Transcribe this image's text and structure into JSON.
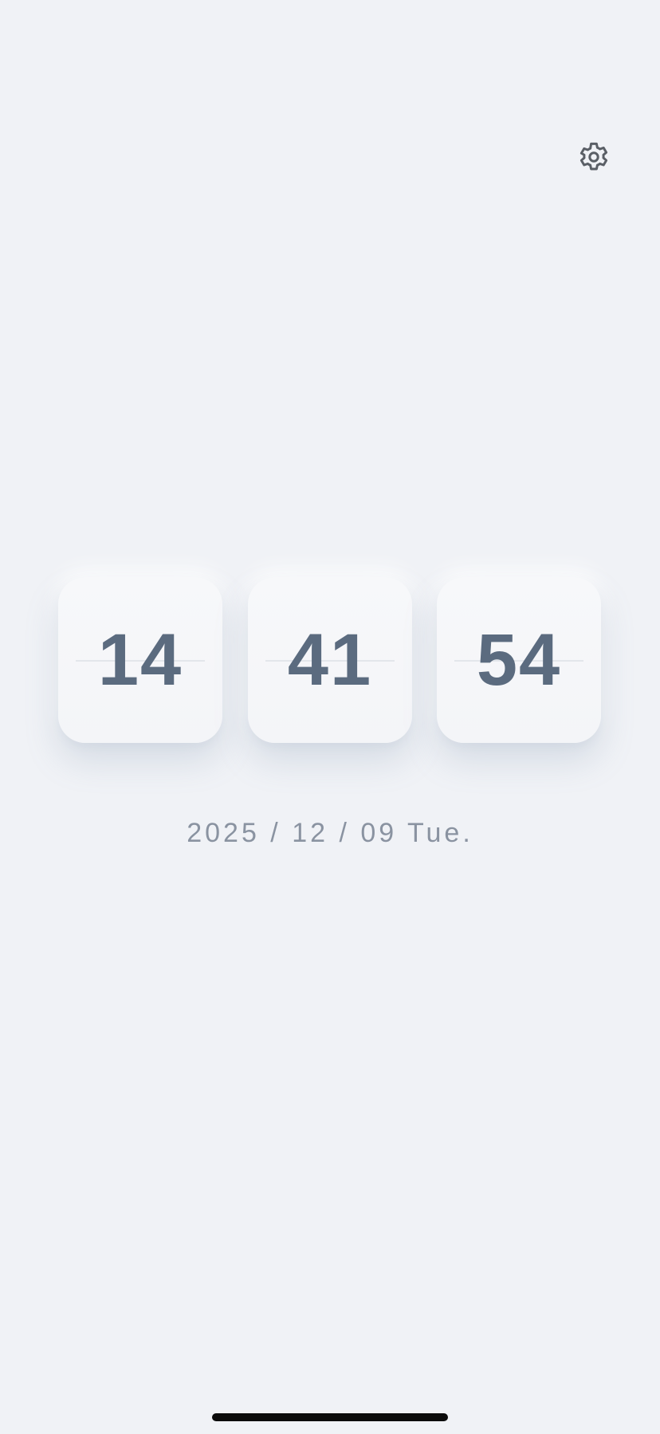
{
  "header": {
    "settings_icon": "gear-icon"
  },
  "clock": {
    "hours": "14",
    "minutes": "41",
    "seconds": "54"
  },
  "date": {
    "text": "2025 / 12 / 09 Tue."
  },
  "colors": {
    "background": "#f0f2f6",
    "card": "#f6f7f9",
    "digits": "#5b6b7f",
    "date_text": "#8a93a1",
    "icon": "#5a5f66"
  }
}
